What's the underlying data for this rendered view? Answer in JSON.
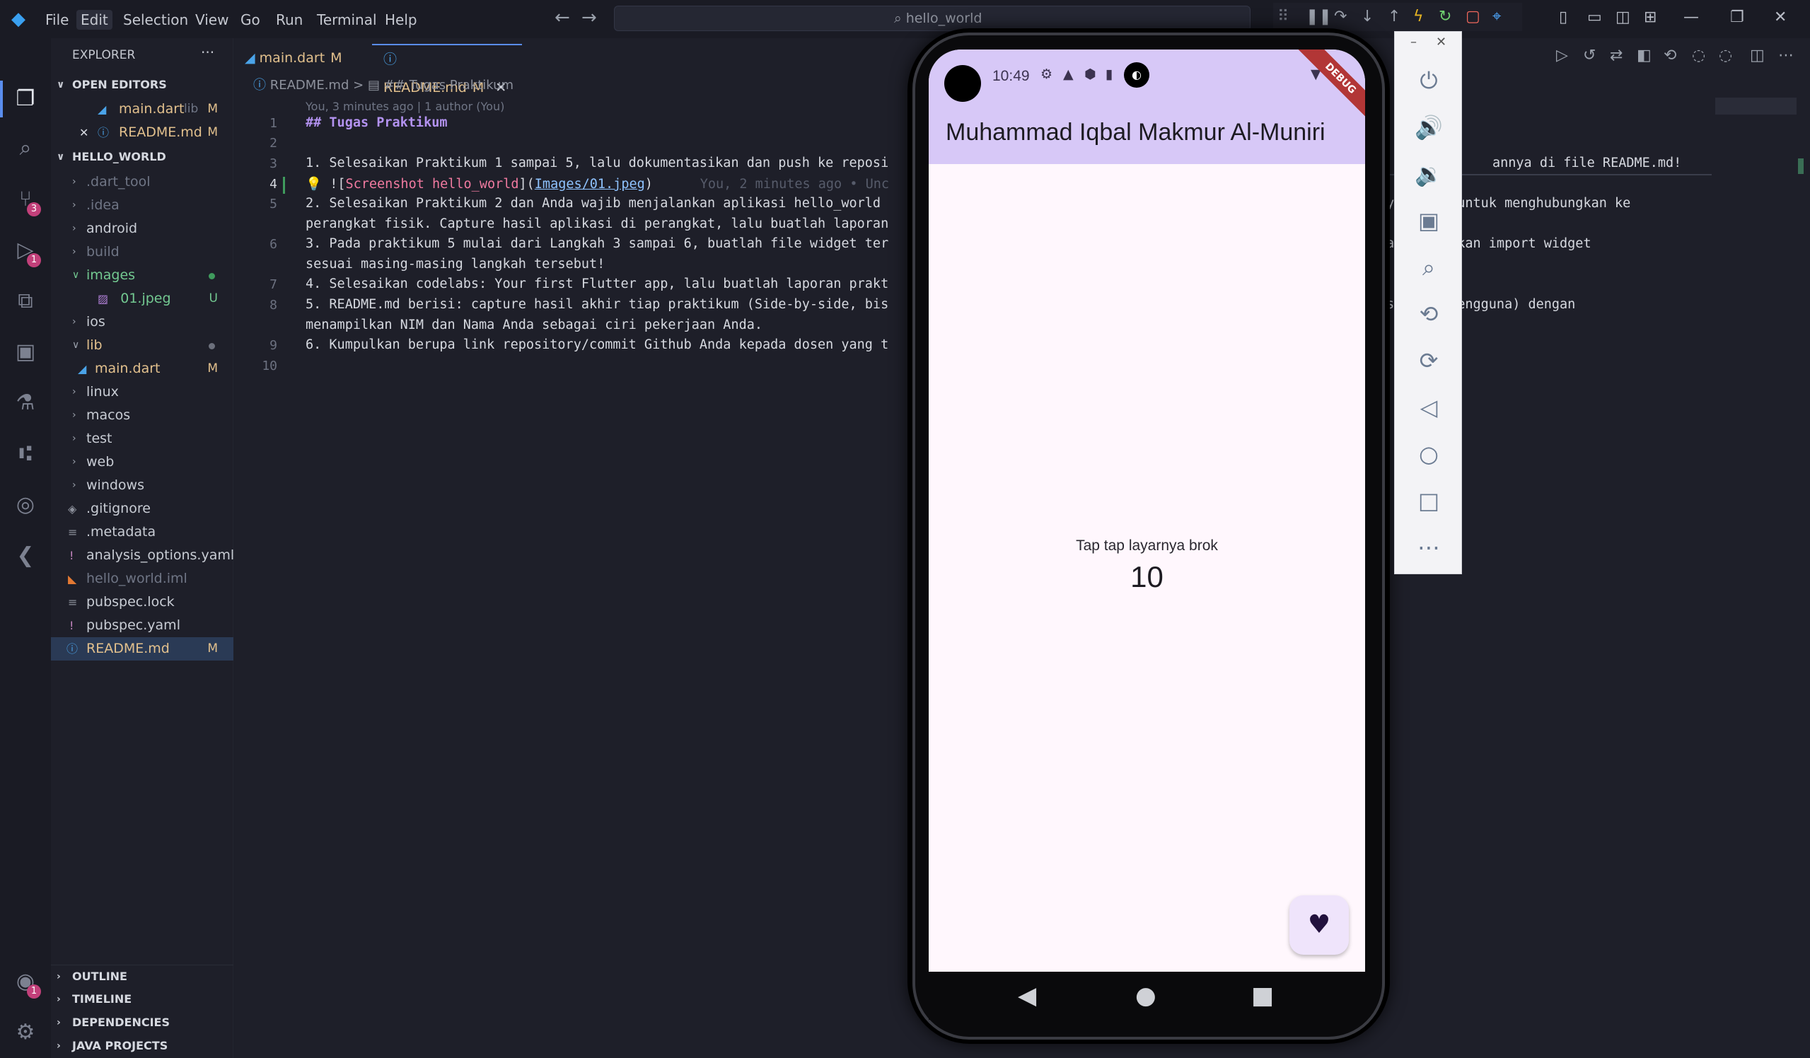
{
  "titlebar": {
    "menu": [
      "File",
      "Edit",
      "Selection",
      "View",
      "Go",
      "Run",
      "Terminal",
      "Help"
    ],
    "active_menu": "Edit",
    "search": "hello_world"
  },
  "sidebar": {
    "title": "EXPLORER",
    "more": "···",
    "open_editors_label": "OPEN EDITORS",
    "open_editors": [
      {
        "name": "main.dart",
        "hint": "lib",
        "status": "M"
      },
      {
        "name": "README.md",
        "status": "M"
      }
    ],
    "project_label": "HELLO_WORLD",
    "files": [
      {
        "name": ".dart_tool",
        "status": ""
      },
      {
        "name": ".idea",
        "status": ""
      },
      {
        "name": "android",
        "status": ""
      },
      {
        "name": "build",
        "status": ""
      },
      {
        "name": "images",
        "status": ""
      },
      {
        "name": "01.jpeg",
        "status": "U"
      },
      {
        "name": "ios",
        "status": ""
      },
      {
        "name": "lib",
        "status": ""
      },
      {
        "name": "main.dart",
        "status": "M"
      },
      {
        "name": "linux",
        "status": ""
      },
      {
        "name": "macos",
        "status": ""
      },
      {
        "name": "test",
        "status": ""
      },
      {
        "name": "web",
        "status": ""
      },
      {
        "name": "windows",
        "status": ""
      },
      {
        "name": ".gitignore",
        "status": ""
      },
      {
        "name": ".metadata",
        "status": ""
      },
      {
        "name": "analysis_options.yaml",
        "status": ""
      },
      {
        "name": "hello_world.iml",
        "status": ""
      },
      {
        "name": "pubspec.lock",
        "status": ""
      },
      {
        "name": "pubspec.yaml",
        "status": ""
      },
      {
        "name": "README.md",
        "status": "M"
      }
    ],
    "bottom_sections": [
      "OUTLINE",
      "TIMELINE",
      "DEPENDENCIES",
      "JAVA PROJECTS"
    ]
  },
  "activity_badges": {
    "scm": "3",
    "debug": "1",
    "accounts": "1"
  },
  "editor": {
    "tabs": [
      {
        "name": "main.dart",
        "status": "M"
      },
      {
        "name": "README.md",
        "status": "M"
      }
    ],
    "breadcrumb": {
      "file": "README.md",
      "sep": ">",
      "symbol": "## Tugas Praktikum"
    },
    "blame": "You, 3 minutes ago | 1 author (You)",
    "line_numbers": [
      "1",
      "2",
      "3",
      "4",
      "5",
      "",
      "6",
      "",
      "7",
      "8",
      "",
      "9",
      "10"
    ],
    "lines": {
      "l1": "## Tugas Praktikum",
      "l3": "1. Selesaikan Praktikum 1 sampai 5, lalu dokumentasikan dan push ke reposi",
      "l3_right": "annya di file README.md!",
      "l4_prefix": "![",
      "l4_link": "Screenshot hello_world",
      "l4_mid": "](",
      "l4_url": "Images/01.jpeg",
      "l4_end": ")",
      "l4_ghost": "You, 2 minutes ago • Unc",
      "l5": "2. Selesaikan Praktikum 2 dan Anda wajib menjalankan aplikasi hello_world",
      "l5_right": "y...aman untuk menghubungkan ke",
      "l5b": "perangkat fisik. Capture hasil aplikasi di perangkat, lalu buatlah laporan",
      "l6": "3. Pada praktikum 5 mulai dari Langkah 3 sampai 6, buatlah file widget ter",
      "l6_right": "a  melakukan import widget",
      "l6b": "sesuai masing-masing langkah tersebut!",
      "l7": "4. Selesaikan codelabs: Your first Flutter app, lalu buatlah laporan prakt",
      "l8": "5. README.md berisi: capture hasil akhir tiap praktikum (Side-by-side, bis",
      "l8_right": "si dari pengguna) dengan",
      "l8b": "menampilkan NIM dan Nama Anda sebagai ciri pekerjaan Anda.",
      "l9": "6. Kumpulkan berupa link repository/commit Github Anda kepada dosen yang t"
    }
  },
  "emulator": {
    "time": "10:49",
    "debug_banner": "DEBUG",
    "app_title": "Muhammad Iqbal Makmur Al-Muniri",
    "tap_label": "Tap tap layarnya brok",
    "counter": "10"
  },
  "colors": {
    "accent": "#5a8dee",
    "appbar": "#d7c8f7",
    "modified": "#e2c08d",
    "untracked": "#73c991"
  }
}
